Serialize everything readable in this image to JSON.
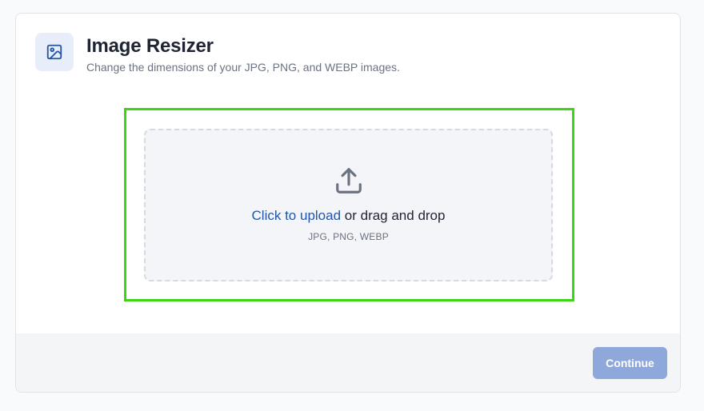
{
  "header": {
    "title": "Image Resizer",
    "subtitle": "Change the dimensions of your JPG, PNG, and WEBP images.",
    "icon": "image-icon"
  },
  "dropzone": {
    "icon": "upload-icon",
    "link_text": "Click to upload",
    "rest_text": " or drag and drop",
    "formats": "JPG, PNG, WEBP"
  },
  "footer": {
    "continue_label": "Continue"
  },
  "colors": {
    "accent": "#2456a6",
    "highlight": "#3dd616",
    "button_disabled": "#8fa8dc"
  }
}
